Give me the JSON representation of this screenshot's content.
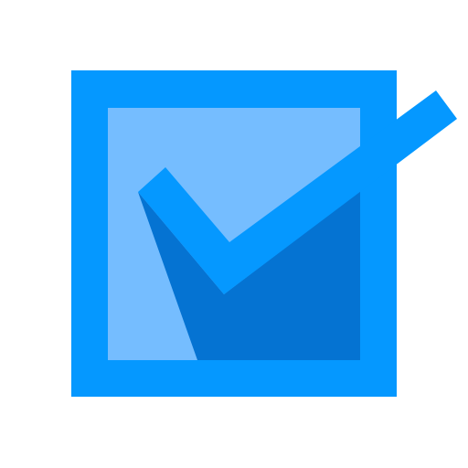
{
  "icon": {
    "name": "checked-checkbox-icon",
    "colors": {
      "background": "#ffffff",
      "box_border": "#0598FF",
      "box_fill": "#75BDFF",
      "shadow": "#0573D2",
      "check": "#0598FF"
    },
    "checked": true
  }
}
